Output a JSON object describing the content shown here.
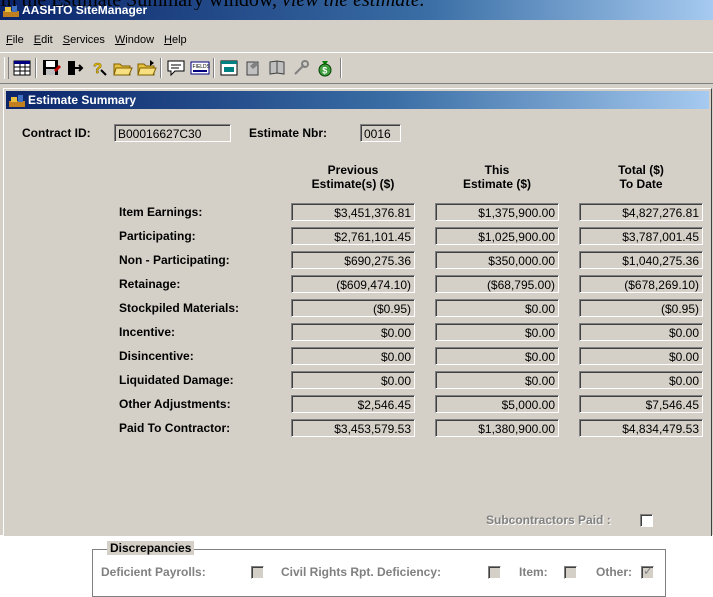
{
  "page_caption": {
    "prefix": "In the Estimate Summary window, ",
    "italic": "view the estimate."
  },
  "app_title": "AASHTO SiteManager",
  "menu": [
    {
      "label": "File",
      "key": "F",
      "rest": "ile"
    },
    {
      "label": "Edit",
      "key": "E",
      "rest": "dit"
    },
    {
      "label": "Services",
      "key": "S",
      "rest": "ervices"
    },
    {
      "label": "Window",
      "key": "W",
      "rest": "indow"
    },
    {
      "label": "Help",
      "key": "H",
      "rest": "elp"
    }
  ],
  "toolbar_icons": [
    "grid-icon",
    "save-icon",
    "exit-icon",
    "help-icon",
    "open-folder-icon",
    "open-folder-alt-icon",
    "comment-icon",
    "fields-icon",
    "window-icon",
    "notepad-icon",
    "diary-icon",
    "tool-icon",
    "money-bag-icon"
  ],
  "window_title": "Estimate Summary",
  "contract": {
    "label": "Contract ID:",
    "value": "B00016627C30"
  },
  "estimate_nbr": {
    "label": "Estimate Nbr:",
    "value": "0016"
  },
  "columns": {
    "previous": [
      "Previous",
      "Estimate(s) ($)"
    ],
    "this": [
      "This",
      "Estimate ($)"
    ],
    "total": [
      "Total ($)",
      "To Date"
    ]
  },
  "rows": [
    {
      "label": "Item Earnings:",
      "previous": "$3,451,376.81",
      "this": "$1,375,900.00",
      "total": "$4,827,276.81"
    },
    {
      "label": "Participating:",
      "previous": "$2,761,101.45",
      "this": "$1,025,900.00",
      "total": "$3,787,001.45"
    },
    {
      "label": "Non - Participating:",
      "previous": "$690,275.36",
      "this": "$350,000.00",
      "total": "$1,040,275.36"
    },
    {
      "label": "Retainage:",
      "previous": "($609,474.10)",
      "this": "($68,795.00)",
      "total": "($678,269.10)"
    },
    {
      "label": "Stockpiled Materials:",
      "previous": "($0.95)",
      "this": "$0.00",
      "total": "($0.95)"
    },
    {
      "label": "Incentive:",
      "previous": "$0.00",
      "this": "$0.00",
      "total": "$0.00"
    },
    {
      "label": "Disincentive:",
      "previous": "$0.00",
      "this": "$0.00",
      "total": "$0.00"
    },
    {
      "label": "Liquidated Damage:",
      "previous": "$0.00",
      "this": "$0.00",
      "total": "$0.00"
    },
    {
      "label": "Other Adjustments:",
      "previous": "$2,546.45",
      "this": "$5,000.00",
      "total": "$7,546.45"
    },
    {
      "label": "Paid To Contractor:",
      "previous": "$3,453,579.53",
      "this": "$1,380,900.00",
      "total": "$4,834,479.53"
    }
  ],
  "discrepancies": {
    "title": "Discrepancies",
    "deficient_payrolls": {
      "label": "Deficient Payrolls:",
      "checked": false
    },
    "civil_rights": {
      "label": "Civil Rights Rpt. Deficiency:",
      "checked": false
    },
    "item": {
      "label": "Item:",
      "checked": false
    },
    "other": {
      "label": "Other:",
      "checked": true
    }
  },
  "subcontractors_paid": {
    "label": "Subcontractors Paid :",
    "checked": false
  }
}
